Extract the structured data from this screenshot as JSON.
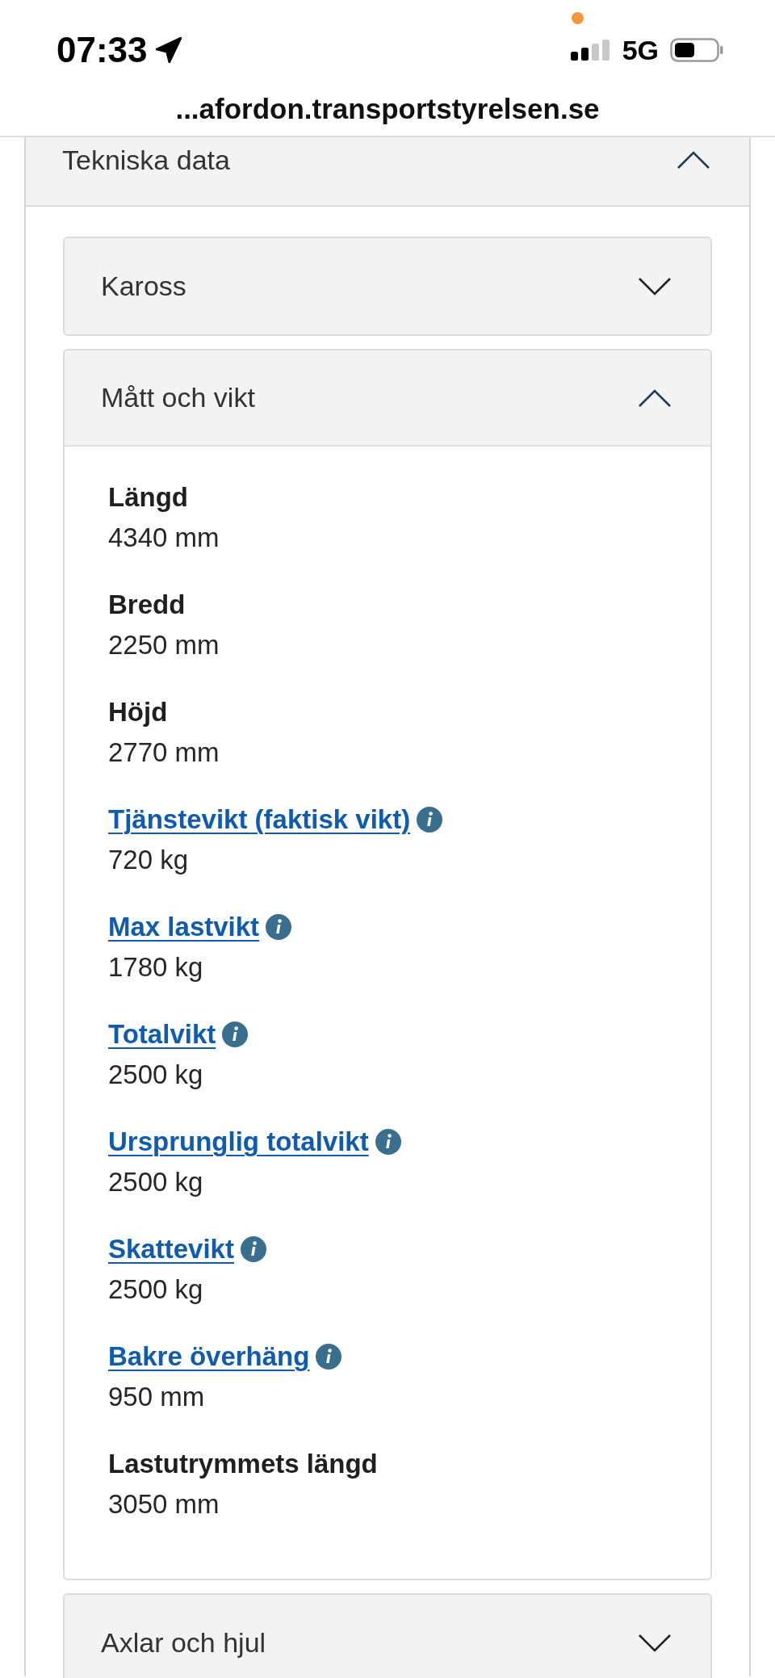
{
  "status_bar": {
    "time": "07:33",
    "network": "5G"
  },
  "address_bar": {
    "url": "...afordon.transportstyrelsen.se"
  },
  "section": {
    "title": "Tekniska data",
    "expanded": true,
    "panels": [
      {
        "title": "Kaross",
        "expanded": false
      },
      {
        "title": "Mått och vikt",
        "expanded": true,
        "fields": [
          {
            "kind": "plain",
            "label": "Längd",
            "value": "4340 mm"
          },
          {
            "kind": "plain",
            "label": "Bredd",
            "value": "2250 mm"
          },
          {
            "kind": "plain",
            "label": "Höjd",
            "value": "2770 mm"
          },
          {
            "kind": "link",
            "label": "Tjänstevikt (faktisk vikt)",
            "value": "720 kg"
          },
          {
            "kind": "link",
            "label": "Max lastvikt",
            "value": "1780 kg"
          },
          {
            "kind": "link",
            "label": "Totalvikt",
            "value": "2500 kg"
          },
          {
            "kind": "link",
            "label": "Ursprunglig totalvikt",
            "value": "2500 kg"
          },
          {
            "kind": "link",
            "label": "Skattevikt",
            "value": "2500 kg"
          },
          {
            "kind": "link",
            "label": "Bakre överhäng",
            "value": "950 mm"
          },
          {
            "kind": "plain",
            "label": "Lastutrymmets längd",
            "value": "3050 mm"
          }
        ]
      },
      {
        "title": "Axlar och hjul",
        "expanded": false
      }
    ]
  }
}
